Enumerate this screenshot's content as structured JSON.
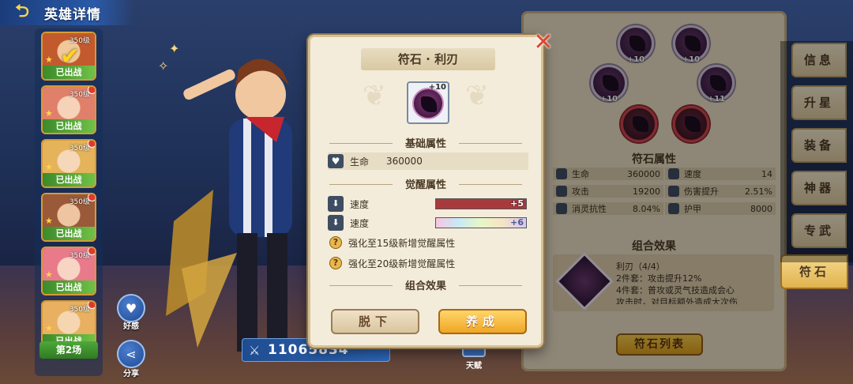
{
  "header": {
    "back_icon": "back-arrow-icon",
    "title": "英雄详情"
  },
  "hero_list": {
    "cards": [
      {
        "level": "350级",
        "badge": "已出战",
        "face_color": "#c25a2e",
        "checked": true
      },
      {
        "level": "350级",
        "badge": "已出战",
        "face_color": "#e0806a",
        "checked": false
      },
      {
        "level": "350级",
        "badge": "已出战",
        "face_color": "#e4b35a",
        "checked": false
      },
      {
        "level": "350级",
        "badge": "已出战",
        "face_color": "#9a5a3a",
        "checked": false
      },
      {
        "level": "350级",
        "badge": "已出战",
        "face_color": "#e87a8a",
        "checked": false
      },
      {
        "level": "350级",
        "badge": "已出战",
        "face_color": "#e8b060",
        "checked": false
      }
    ],
    "round_label": "第2场"
  },
  "side_buttons": {
    "like_label": "好感",
    "share_label": "分享"
  },
  "power": {
    "value": "11065834"
  },
  "talent": {
    "label": "天赋"
  },
  "right_panel": {
    "rune_slots": [
      {
        "plus": "+10",
        "color": "purple"
      },
      {
        "plus": "+10",
        "color": "purple"
      },
      {
        "plus": "+10",
        "color": "purple"
      },
      {
        "plus": "+11",
        "color": "purple"
      },
      {
        "plus": "",
        "color": "red"
      },
      {
        "plus": "",
        "color": "red"
      }
    ],
    "rune_attr_title": "符石属性",
    "stats": [
      {
        "name": "生命",
        "value": "360000"
      },
      {
        "name": "速度",
        "value": "14"
      },
      {
        "name": "攻击",
        "value": "19200"
      },
      {
        "name": "伤害提升",
        "value": "2.51%"
      },
      {
        "name": "消灵抗性",
        "value": "8.04%"
      },
      {
        "name": "护甲",
        "value": "8000"
      }
    ],
    "combo_title": "组合效果",
    "combo": {
      "name": "利刃（4/4）",
      "line2": "2件套：攻击提升12%",
      "line4": "4件套：普攻或灵气技造成会心",
      "line5": "攻击时，对目标额外造成大次伤"
    },
    "rune_list_button": "符石列表"
  },
  "tabs": [
    {
      "label": "信息",
      "active": false
    },
    {
      "label": "升星",
      "active": false
    },
    {
      "label": "装备",
      "active": false
    },
    {
      "label": "神器",
      "active": false
    },
    {
      "label": "专武",
      "active": false
    },
    {
      "label": "符石",
      "active": true
    }
  ],
  "modal": {
    "title": "符石 · 利刃",
    "close_icon": "close-x-icon",
    "rune_level": "+10",
    "base_attr_title": "基础属性",
    "base_stat": {
      "name": "生命",
      "value": "360000"
    },
    "awaken_attr_title": "觉醒属性",
    "awaken_stats": [
      {
        "name": "速度",
        "bonus": "+5",
        "fill_percent": 100,
        "color": "#a83a3e"
      },
      {
        "name": "速度",
        "bonus": "+6",
        "fill_percent": 100,
        "color": "rainbow"
      }
    ],
    "hints": [
      "强化至15级新增觉醒属性",
      "强化至20级新增觉醒属性"
    ],
    "combo_title": "组合效果",
    "remove_button": "脱下",
    "train_button": "养成"
  },
  "colors": {
    "accent_gold": "#efa625",
    "badge_green": "#4fa83a",
    "close_red": "#e2452d"
  }
}
